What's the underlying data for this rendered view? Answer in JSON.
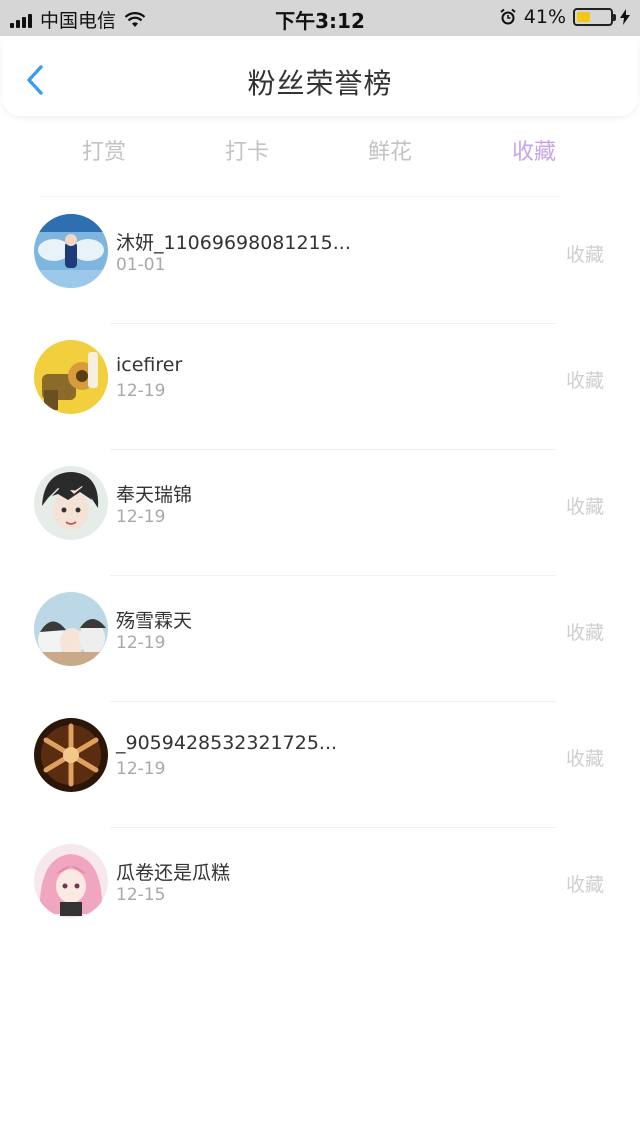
{
  "status_bar": {
    "carrier": "中国电信",
    "time": "下午3:12",
    "battery_text": "41%",
    "battery_level": 0.41,
    "battery_color": "#f5c518",
    "icons": [
      "signal-icon",
      "wifi-icon",
      "alarm-icon",
      "battery-icon",
      "charging-bolt-icon"
    ]
  },
  "header": {
    "title": "粉丝荣誉榜",
    "back_icon": "chevron-left-icon",
    "accent_color": "#3a9bf0"
  },
  "tabs": [
    {
      "label": "打赏",
      "active": false
    },
    {
      "label": "打卡",
      "active": false
    },
    {
      "label": "鲜花",
      "active": false
    },
    {
      "label": "收藏",
      "active": true
    }
  ],
  "active_tab_color": "#c6a6e6",
  "fans": [
    {
      "name": "沐妍_11069698081215...",
      "date": "01-01",
      "action": "收藏",
      "avatar": "anime-character-avatar"
    },
    {
      "name": "icefirer",
      "date": "12-19",
      "action": "收藏",
      "avatar": "robot-character-avatar"
    },
    {
      "name": "奉天瑞锦",
      "date": "12-19",
      "action": "收藏",
      "avatar": "anime-boy-avatar"
    },
    {
      "name": "殇雪霖天",
      "date": "12-19",
      "action": "收藏",
      "avatar": "anime-group-avatar"
    },
    {
      "name": "_9059428532321725...",
      "date": "12-19",
      "action": "收藏",
      "avatar": "snowflake-avatar"
    },
    {
      "name": "瓜卷还是瓜糕",
      "date": "12-15",
      "action": "收藏",
      "avatar": "pink-hair-girl-avatar"
    }
  ]
}
